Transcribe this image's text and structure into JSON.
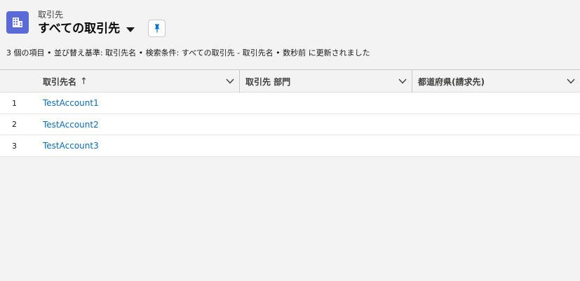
{
  "header": {
    "object_label": "取引先",
    "title": "すべての取引先",
    "meta": "3 個の項目 • 並び替え基準: 取引先名 • 検索条件: すべての取引先 - 取引先名 • 数秒前 に更新されました"
  },
  "icons": {
    "object": "account-building-icon",
    "caret": "caret-down-icon",
    "pin": "pin-icon",
    "sort": "arrow-up-icon",
    "column_menu": "chevron-down-icon"
  },
  "colors": {
    "object_icon_bg": "#5a6ad6",
    "link": "#0b6cb5",
    "pin": "#0176d3"
  },
  "table": {
    "columns": [
      {
        "label": "取引先名",
        "sorted": "ascending",
        "sort_arrow": "↑"
      },
      {
        "label": "取引先 部門"
      },
      {
        "label": "都道府県(請求先)"
      }
    ],
    "rows": [
      {
        "num": "1",
        "name": "TestAccount1"
      },
      {
        "num": "2",
        "name": "TestAccount2"
      },
      {
        "num": "3",
        "name": "TestAccount3"
      }
    ]
  }
}
